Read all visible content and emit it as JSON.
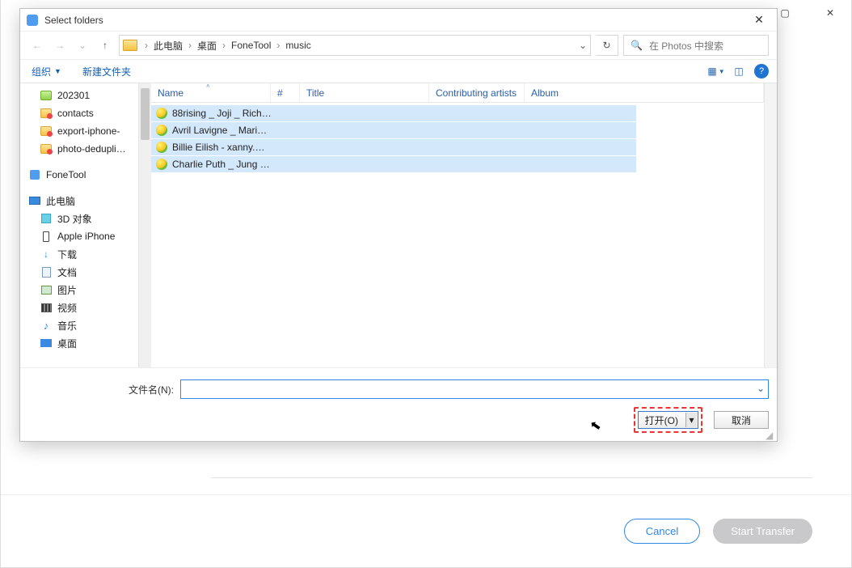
{
  "outer": {
    "buttons": {
      "maximize": "▢",
      "close": "✕"
    },
    "cancel": "Cancel",
    "start": "Start Transfer"
  },
  "dialog": {
    "title": "Select folders",
    "close": "✕",
    "nav": {
      "back": "←",
      "forward": "→",
      "up": "↑",
      "history_dd": "⌄",
      "refresh": "↻"
    },
    "breadcrumb": [
      "此电脑",
      "桌面",
      "FoneTool",
      "music"
    ],
    "search_placeholder": "在 Photos 中搜索",
    "toolbar": {
      "organize": "组织",
      "newfolder": "新建文件夹"
    },
    "tree": [
      {
        "icon": "green",
        "label": "202301",
        "ind": true
      },
      {
        "icon": "orange",
        "label": "contacts",
        "ind": true
      },
      {
        "icon": "orange",
        "label": "export-iphone-",
        "ind": true
      },
      {
        "icon": "orange",
        "label": "photo-dedupli…",
        "ind": true
      },
      {
        "icon": "app",
        "label": "FoneTool",
        "ind": false,
        "gap": true
      },
      {
        "icon": "pc",
        "label": "此电脑",
        "ind": false,
        "gap": true
      },
      {
        "icon": "cube",
        "label": "3D 对象",
        "ind": true
      },
      {
        "icon": "phone",
        "label": "Apple iPhone",
        "ind": true
      },
      {
        "icon": "down",
        "label": "下载",
        "ind": true
      },
      {
        "icon": "doc",
        "label": "文档",
        "ind": true
      },
      {
        "icon": "img",
        "label": "图片",
        "ind": true
      },
      {
        "icon": "vid",
        "label": "视频",
        "ind": true
      },
      {
        "icon": "music",
        "label": "音乐",
        "ind": true
      },
      {
        "icon": "desk",
        "label": "桌面",
        "ind": true
      }
    ],
    "columns": {
      "name": "Name",
      "num": "#",
      "title": "Title",
      "artists": "Contributing artists",
      "album": "Album"
    },
    "files": [
      "88rising _ Joji _ Rich…",
      "Avril Lavigne _ Mari…",
      "Billie Eilish - xanny.…",
      "Charlie Puth _ Jung …"
    ],
    "filename_label": "文件名(N):",
    "open": "打开(O)",
    "cancel": "取消"
  }
}
